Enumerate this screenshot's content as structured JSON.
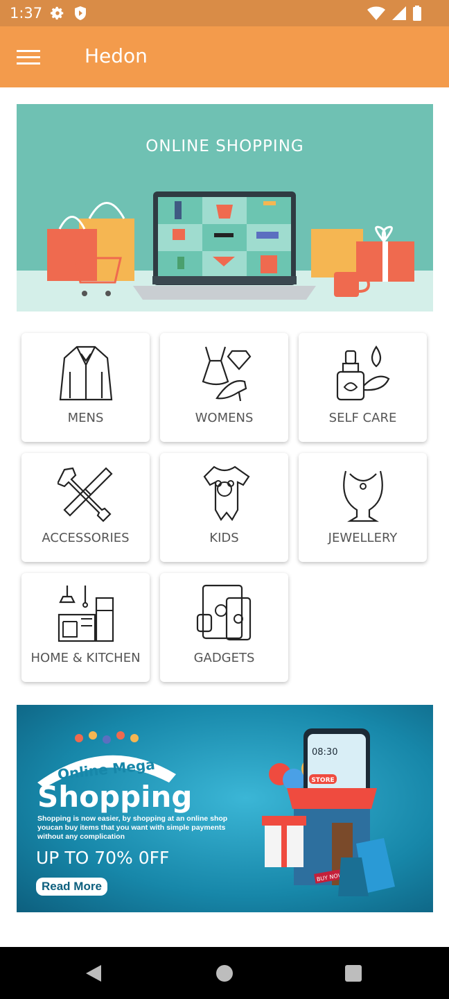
{
  "status_bar": {
    "time": "1:37"
  },
  "app_bar": {
    "title": "Hedon",
    "menu_icon": "hamburger-menu-icon"
  },
  "hero_banner": {
    "title": "ONLINE  SHOPPING"
  },
  "categories": [
    {
      "label": "MENS",
      "icon": "suit-icon"
    },
    {
      "label": "WOMENS",
      "icon": "dress-icon"
    },
    {
      "label": "SELF CARE",
      "icon": "cosmetics-icon"
    },
    {
      "label": "ACCESSORIES",
      "icon": "tools-icon"
    },
    {
      "label": "KIDS",
      "icon": "baby-romper-icon"
    },
    {
      "label": "JEWELLERY",
      "icon": "necklace-icon"
    },
    {
      "label": "HOME & KITCHEN",
      "icon": "kitchen-icon"
    },
    {
      "label": "GADGETS",
      "icon": "devices-icon"
    }
  ],
  "promo_banner": {
    "tag": "Online Mega",
    "headline": "Shopping",
    "body": "Shopping is now easier, by shopping at an online shop youcan buy items that you want with simple payments without any complication",
    "discount": "UP TO 70% 0FF",
    "cta": "Read More",
    "phone_time": "08:30",
    "store_sign": "STORE",
    "buy_now": "BUY NOW"
  },
  "colors": {
    "status_bar": "#d98c47",
    "app_bar": "#f39b4c",
    "hero_bg": "#6fc1b3"
  }
}
